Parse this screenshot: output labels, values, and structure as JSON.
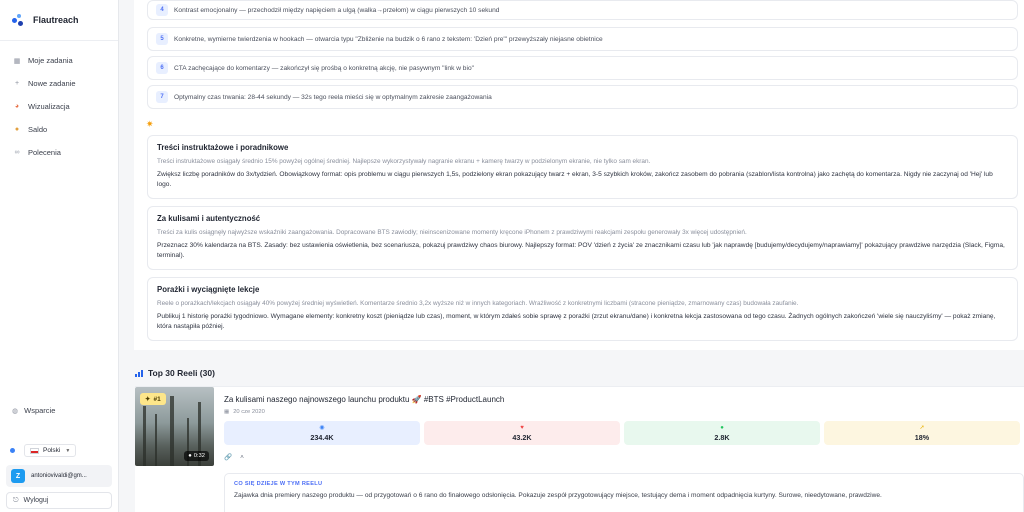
{
  "app": {
    "name": "Flautreach"
  },
  "sidebar": {
    "items": [
      {
        "label": "Moje zadania",
        "icon": "home-icon"
      },
      {
        "label": "Nowe zadanie",
        "icon": "plus-icon"
      },
      {
        "label": "Wizualizacja",
        "icon": "visualization-icon"
      },
      {
        "label": "Saldo",
        "icon": "wallet-icon"
      },
      {
        "label": "Polecenia",
        "icon": "link-icon"
      }
    ],
    "support_label": "Wsparcie",
    "language": "Polski",
    "user": {
      "initial": "Z",
      "email": "antoniovivaldi@gm..."
    },
    "logout_label": "Wyloguj"
  },
  "insights": [
    {
      "num": "4",
      "text": "Kontrast emocjonalny — przechodził między napięciem a ulgą (walka→przełom) w ciągu pierwszych 10 sekund"
    },
    {
      "num": "5",
      "text": "Konkretne, wymierne twierdzenia w hookach — otwarcia typu \"Zbliżenie na budzik o 6 rano z tekstem: 'Dzień pre'\" przewyższały niejasne obietnice"
    },
    {
      "num": "6",
      "text": "CTA zachęcające do komentarzy — zakończył się prośbą o konkretną akcję, nie pasywnym \"link w bio\""
    },
    {
      "num": "7",
      "text": "Optymalny czas trwania: 28-44 sekundy — 32s tego reela mieści się w optymalnym zakresie zaangażowania"
    }
  ],
  "categories": [
    {
      "title": "Treści instruktażowe i poradnikowe",
      "desc": "Treści instruktażowe osiągały średnio 15% powyżej ogólnej średniej. Najlepsze wykorzystywały nagranie ekranu + kamerę twarzy w podzielonym ekranie, nie tylko sam ekran.",
      "rec": "Zwiększ liczbę poradników do 3x/tydzień. Obowiązkowy format: opis problemu w ciągu pierwszych 1,5s, podzielony ekran pokazujący twarz + ekran, 3-5 szybkich kroków, zakończ zasobem do pobrania (szablon/lista kontrolna) jako zachętą do komentarza. Nigdy nie zaczynaj od 'Hej' lub logo."
    },
    {
      "title": "Za kulisami i autentyczność",
      "desc": "Treści za kulis osiągnęły najwyższe wskaźniki zaangażowania. Dopracowane BTS zawiodły; nieinscenizowane momenty kręcone iPhonem z prawdziwymi reakcjami zespołu generowały 3x więcej udostępnień.",
      "rec": "Przeznacz 30% kalendarza na BTS. Zasady: bez ustawienia oświetlenia, bez scenariusza, pokazuj prawdziwy chaos biurowy. Najlepszy format: POV 'dzień z życia' ze znacznikami czasu lub 'jak naprawdę [budujemy/decydujemy/naprawiamy]' pokazujący prawdziwe narzędzia (Slack, Figma, terminal)."
    },
    {
      "title": "Porażki i wyciągnięte lekcje",
      "desc": "Reele o porażkach/lekcjach osiągały 40% powyżej średniej wyświetleń. Komentarze średnio 3,2x wyższe niż w innych kategoriach. Wrażliwość z konkretnymi liczbami (stracone pieniądze, zmarnowany czas) budowała zaufanie.",
      "rec": "Publikuj 1 historię porażki tygodniowo. Wymagane elementy: konkretny koszt (pieniądze lub czas), moment, w którym zdałeś sobie sprawę z porażki (zrzut ekranu/dane) i konkretna lekcja zastosowana od tego czasu. Żadnych ogólnych zakończeń 'wiele się nauczyliśmy' — pokaż zmianę, która nastąpiła później."
    }
  ],
  "top_reels": {
    "title": "Top 30 Reeli (30)",
    "reel": {
      "rank": "#1",
      "duration": "0:32",
      "title": "Za kulisami naszego najnowszego launchu produktu 🚀 #BTS #ProductLaunch",
      "date": "20 cze 2020",
      "stats": [
        {
          "icon": "eye-icon",
          "value": "234.4K",
          "bg": "#e8efff",
          "color": "#3b82f6"
        },
        {
          "icon": "heart-icon",
          "value": "43.2K",
          "bg": "#fdecec",
          "color": "#ef4444"
        },
        {
          "icon": "comment-icon",
          "value": "2.8K",
          "bg": "#e8f8ee",
          "color": "#22c55e"
        },
        {
          "icon": "engagement-icon",
          "value": "18%",
          "bg": "#fdf6e0",
          "color": "#eab308"
        }
      ],
      "analysis_label": "CO SIĘ DZIEJE W TYM REELU",
      "analysis_text": "Zajawka dnia premiery naszego produktu — od przygotowań o 6 rano do finałowego odsłonięcia. Pokazuje zespół przygotowujący miejsce, testujący dema i moment odpadnięcia kurtyny. Surowe, nieedytowane, prawdziwe."
    }
  }
}
